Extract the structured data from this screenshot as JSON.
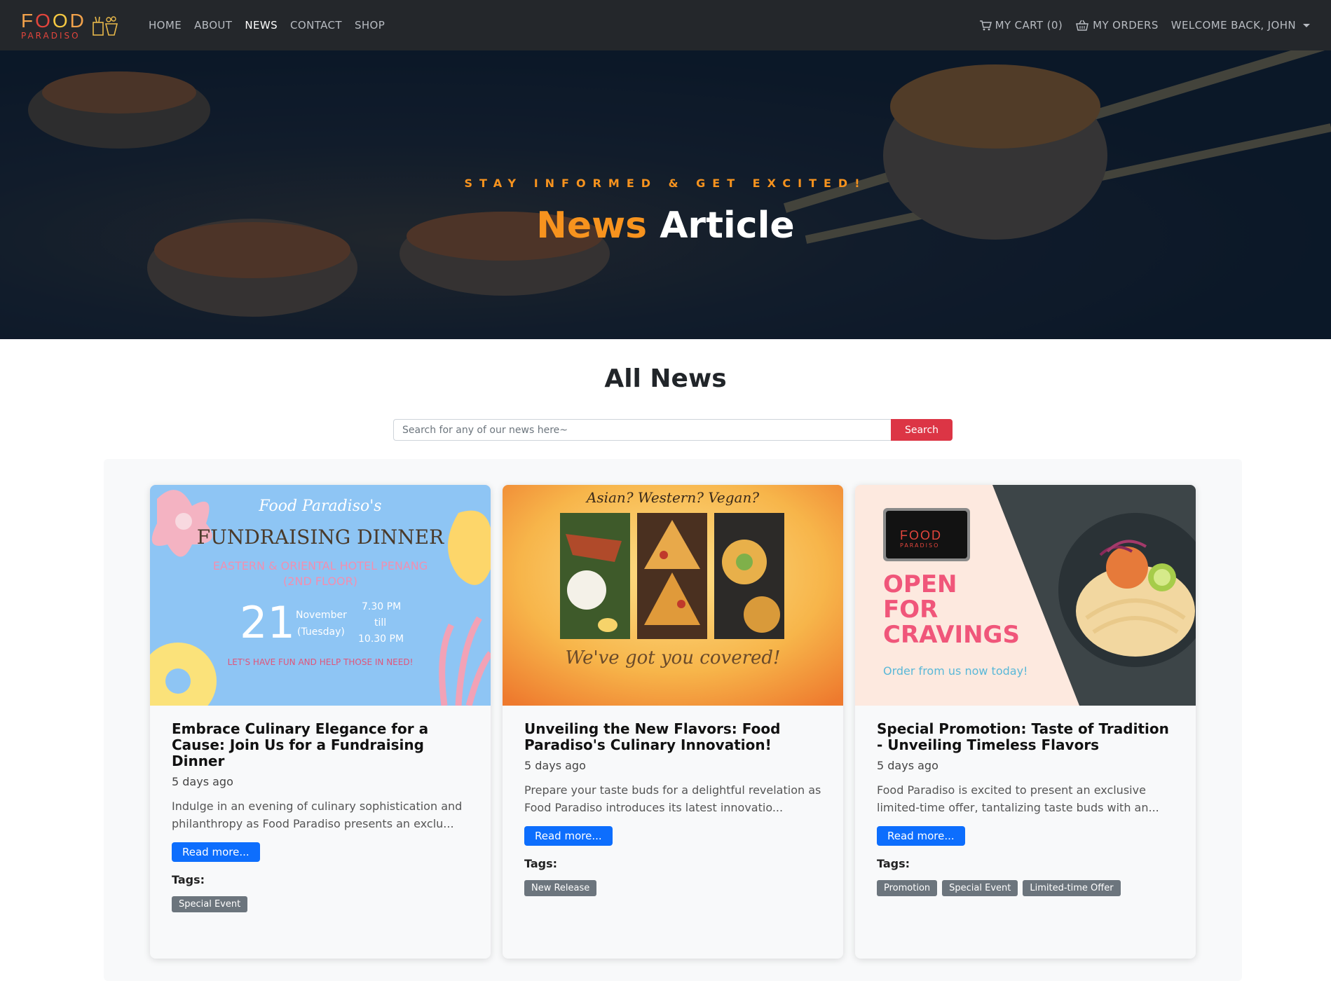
{
  "brand": {
    "name_top": "FOOD",
    "name_bottom": "PARADISO"
  },
  "nav": {
    "links": [
      "HOME",
      "ABOUT",
      "NEWS",
      "CONTACT",
      "SHOP"
    ],
    "active": "NEWS",
    "cart": "MY CART (0)",
    "orders": "MY ORDERS",
    "user": "WELCOME BACK, JOHN"
  },
  "hero": {
    "subtitle": "STAY INFORMED & GET EXCITED!",
    "title_accent": "News",
    "title_rest": "Article"
  },
  "section": {
    "title": "All News"
  },
  "search": {
    "placeholder": "Search for any of our news here~",
    "button": "Search"
  },
  "cards": [
    {
      "title": "Embrace Culinary Elegance for a Cause: Join Us for a Fundraising Dinner",
      "date": "5 days ago",
      "excerpt": "Indulge in an evening of culinary sophistication and philanthropy as Food Paradiso presents an exclu...",
      "read_more": "Read more...",
      "tags_label": "Tags:",
      "tags": [
        "Special Event"
      ],
      "image": {
        "script": "Food Paradiso's",
        "heading": "FUNDRAISING DINNER",
        "venue1": "EASTERN & ORIENTAL HOTEL PENANG",
        "venue2": "(2ND FLOOR)",
        "day": "21",
        "month": "November",
        "weekday": "(Tuesday)",
        "time_start": "7.30 PM",
        "time_till": "till",
        "time_end": "10.30 PM",
        "footer": "LET'S HAVE FUN AND HELP THOSE IN NEED!"
      }
    },
    {
      "title": "Unveiling the New Flavors: Food Paradiso's Culinary Innovation!",
      "date": "5 days ago",
      "excerpt": "Prepare your taste buds for a delightful revelation as Food Paradiso introduces its latest innovatio...",
      "read_more": "Read more...",
      "tags_label": "Tags:",
      "tags": [
        "New Release"
      ],
      "image": {
        "top": "Asian? Western? Vegan?",
        "bottom": "We've got you covered!"
      }
    },
    {
      "title": "Special Promotion: Taste of Tradition - Unveiling Timeless Flavors",
      "date": "5 days ago",
      "excerpt": "Food Paradiso is excited to present an exclusive limited-time offer, tantalizing taste buds with an...",
      "read_more": "Read more...",
      "tags_label": "Tags:",
      "tags": [
        "Promotion",
        "Special Event",
        "Limited-time Offer"
      ],
      "image": {
        "line1": "OPEN",
        "line2": "FOR",
        "line3": "CRAVINGS",
        "cta": "Order from us now today!"
      }
    }
  ],
  "colors": {
    "accent_orange": "#f7931e",
    "search_red": "#dc3545",
    "button_blue": "#0d6efd",
    "tag_gray": "#6c757d",
    "navbar": "#24272b"
  }
}
